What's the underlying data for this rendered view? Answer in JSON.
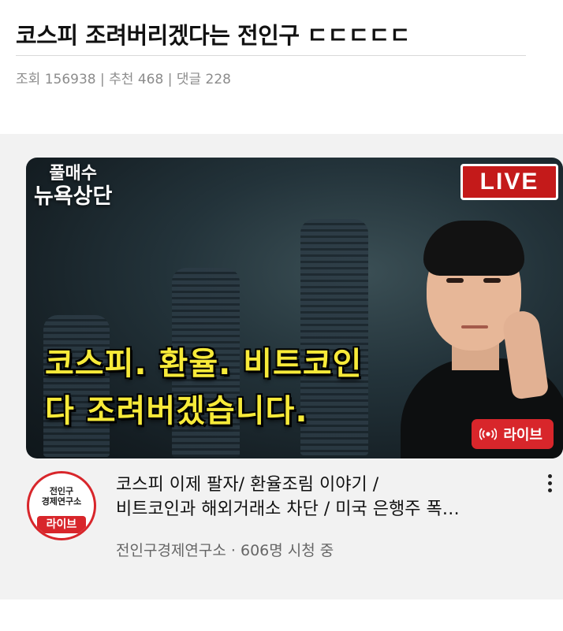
{
  "post": {
    "title": "코스피 조려버리겠다는 전인구 ㄷㄷㄷㄷㄷ",
    "meta": {
      "views_label": "조회",
      "views": "156938",
      "recommend_label": "추천",
      "recommend": "468",
      "comments_label": "댓글",
      "comments": "228",
      "separator": "|"
    }
  },
  "video": {
    "thumbnail": {
      "badge_line1": "풀매수",
      "badge_line2": "뉴욕상단",
      "live_badge": "LIVE",
      "caption_line1": "코스피. 환율. 비트코인",
      "caption_line2": "다 조려버겠습니다.",
      "live_pill": "라이브"
    },
    "channel_avatar": {
      "name_line1": "전인구",
      "name_line2": "경제연구소",
      "live_tag": "라이브"
    },
    "title_line1": "코스피 이제 팔자/ 환율조림 이야기 /",
    "title_line2": "비트코인과 해외거래소 차단 / 미국 은행주 폭…",
    "channel_name": "전인구경제연구소",
    "dot": "·",
    "watching": "606명 시청 중"
  },
  "colors": {
    "live_red": "#d8262b",
    "caption_yellow": "#f7ea39",
    "meta_gray": "#8c8c8c"
  },
  "icons": {
    "live_pill_icon": "broadcast-icon",
    "more": "more-vertical-icon"
  }
}
